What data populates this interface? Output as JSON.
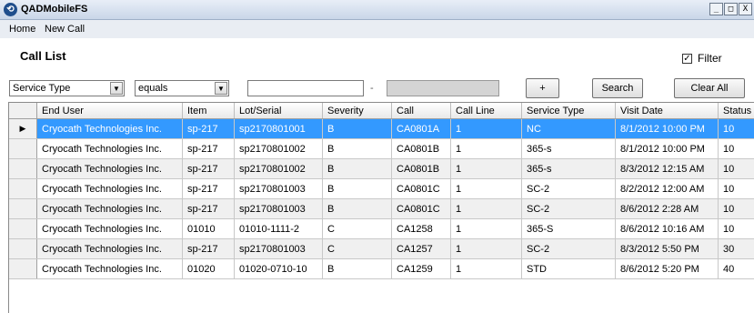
{
  "window": {
    "title": "QADMobileFS",
    "controls": [
      "_",
      "□",
      "X"
    ]
  },
  "menu": {
    "items": [
      "Home",
      "New Call"
    ]
  },
  "page": {
    "title": "Call List"
  },
  "filter": {
    "label": "Filter",
    "checked": true
  },
  "criteria": {
    "field": "Service Type",
    "operator": "equals",
    "value": "",
    "separator": "-",
    "value2": ""
  },
  "buttons": {
    "add": "+",
    "search": "Search",
    "clear_all": "Clear All"
  },
  "table": {
    "columns": [
      "End User",
      "Item",
      "Lot/Serial",
      "Severity",
      "Call",
      "Call Line",
      "Service Type",
      "Visit Date",
      "Status"
    ],
    "selected_row": 0,
    "rows": [
      [
        "Cryocath Technologies Inc.",
        "sp-217",
        "sp2170801001",
        "B",
        "CA0801A",
        "1",
        "NC",
        "8/1/2012 10:00 PM",
        "10"
      ],
      [
        "Cryocath Technologies Inc.",
        "sp-217",
        "sp2170801002",
        "B",
        "CA0801B",
        "1",
        "365-s",
        "8/1/2012 10:00 PM",
        "10"
      ],
      [
        "Cryocath Technologies Inc.",
        "sp-217",
        "sp2170801002",
        "B",
        "CA0801B",
        "1",
        "365-s",
        "8/3/2012 12:15 AM",
        "10"
      ],
      [
        "Cryocath Technologies Inc.",
        "sp-217",
        "sp2170801003",
        "B",
        "CA0801C",
        "1",
        "SC-2",
        "8/2/2012 12:00 AM",
        "10"
      ],
      [
        "Cryocath Technologies Inc.",
        "sp-217",
        "sp2170801003",
        "B",
        "CA0801C",
        "1",
        "SC-2",
        "8/6/2012 2:28 AM",
        "10"
      ],
      [
        "Cryocath Technologies Inc.",
        "01010",
        "01010-1111-2",
        "C",
        "CA1258",
        "1",
        "365-S",
        "8/6/2012 10:16 AM",
        "10"
      ],
      [
        "Cryocath Technologies Inc.",
        "sp-217",
        "sp2170801003",
        "C",
        "CA1257",
        "1",
        "SC-2",
        "8/3/2012 5:50 PM",
        "30"
      ],
      [
        "Cryocath Technologies Inc.",
        "01020",
        "01020-0710-10",
        "B",
        "CA1259",
        "1",
        "STD",
        "8/6/2012 5:20 PM",
        "40"
      ]
    ]
  }
}
